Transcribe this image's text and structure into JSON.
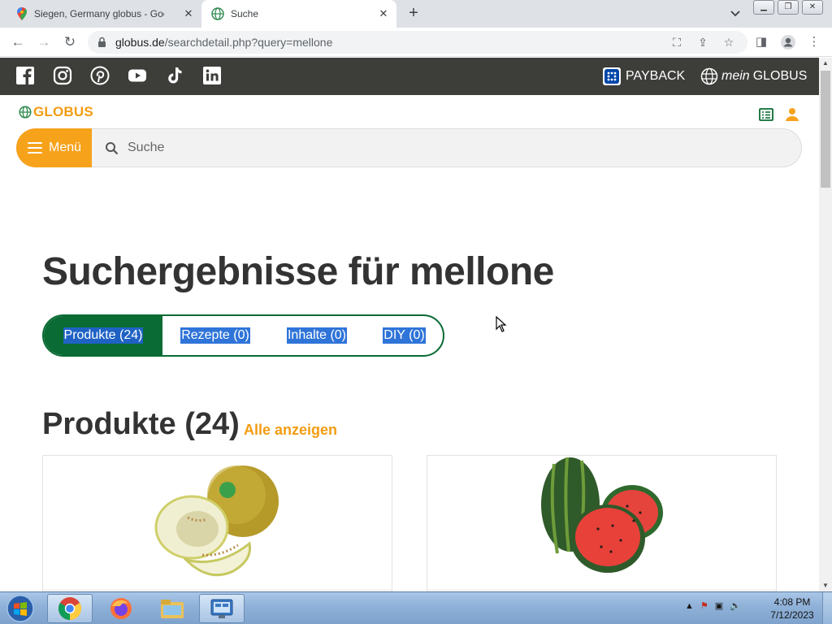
{
  "browser": {
    "tabs": [
      {
        "title": "Siegen, Germany globus - Googl",
        "icon": "google-maps-icon",
        "active": false
      },
      {
        "title": "Suche",
        "icon": "globus-globe-icon",
        "active": true
      }
    ],
    "new_tab": "+",
    "address": {
      "domain": "globus.de",
      "path": "/searchdetail.php?query=mellone"
    }
  },
  "site": {
    "social_icons": [
      "facebook-icon",
      "instagram-icon",
      "pinterest-icon",
      "youtube-icon",
      "tiktok-icon",
      "linkedin-icon"
    ],
    "payback_label": "PAYBACK",
    "mein_prefix": "mein",
    "mein_brand": "GLOBUS",
    "logo_text": "GLOBUS",
    "menu_label": "Menü",
    "search_placeholder": "Suche",
    "results_title": "Suchergebnisse für mellone",
    "filter_tabs": [
      {
        "label": "Produkte (24)",
        "active": true
      },
      {
        "label": "Rezepte (0)",
        "active": false
      },
      {
        "label": "Inhalte (0)",
        "active": false
      },
      {
        "label": "DIY (0)",
        "active": false
      }
    ],
    "products_heading": "Produkte (24)",
    "show_all_label": "Alle anzeigen",
    "products": [
      {
        "image": "honeydew-melon-image"
      },
      {
        "image": "watermelon-image"
      }
    ]
  },
  "colors": {
    "accent_orange": "#f7a21b",
    "tab_green": "#0a6b34",
    "header_dark": "#3d3d3a"
  },
  "taskbar": {
    "apps": [
      "chrome-icon",
      "firefox-icon",
      "file-explorer-icon",
      "control-panel-icon"
    ],
    "time": "4:08 PM",
    "date": "7/12/2023"
  }
}
